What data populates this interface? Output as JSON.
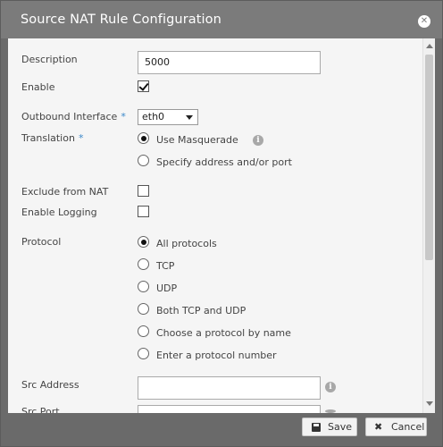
{
  "dialog": {
    "title": "Source NAT Rule Configuration",
    "close_icon": "close-icon"
  },
  "form": {
    "description": {
      "label": "Description",
      "value": "5000"
    },
    "enable": {
      "label": "Enable",
      "checked": true
    },
    "outbound_interface": {
      "label": "Outbound Interface",
      "required_mark": "*",
      "value": "eth0"
    },
    "translation": {
      "label": "Translation",
      "required_mark": "*",
      "options": [
        "Use Masquerade",
        "Specify address and/or port"
      ],
      "selected": "Use Masquerade"
    },
    "exclude_from_nat": {
      "label": "Exclude from NAT",
      "checked": false
    },
    "enable_logging": {
      "label": "Enable Logging",
      "checked": false
    },
    "protocol": {
      "label": "Protocol",
      "options": [
        "All protocols",
        "TCP",
        "UDP",
        "Both TCP and UDP",
        "Choose a protocol by name",
        "Enter a protocol number"
      ],
      "selected": "All protocols"
    },
    "src_address": {
      "label": "Src Address",
      "value": ""
    },
    "src_port": {
      "label": "Src Port",
      "value": ""
    }
  },
  "footer": {
    "save_label": "Save",
    "cancel_label": "Cancel"
  }
}
